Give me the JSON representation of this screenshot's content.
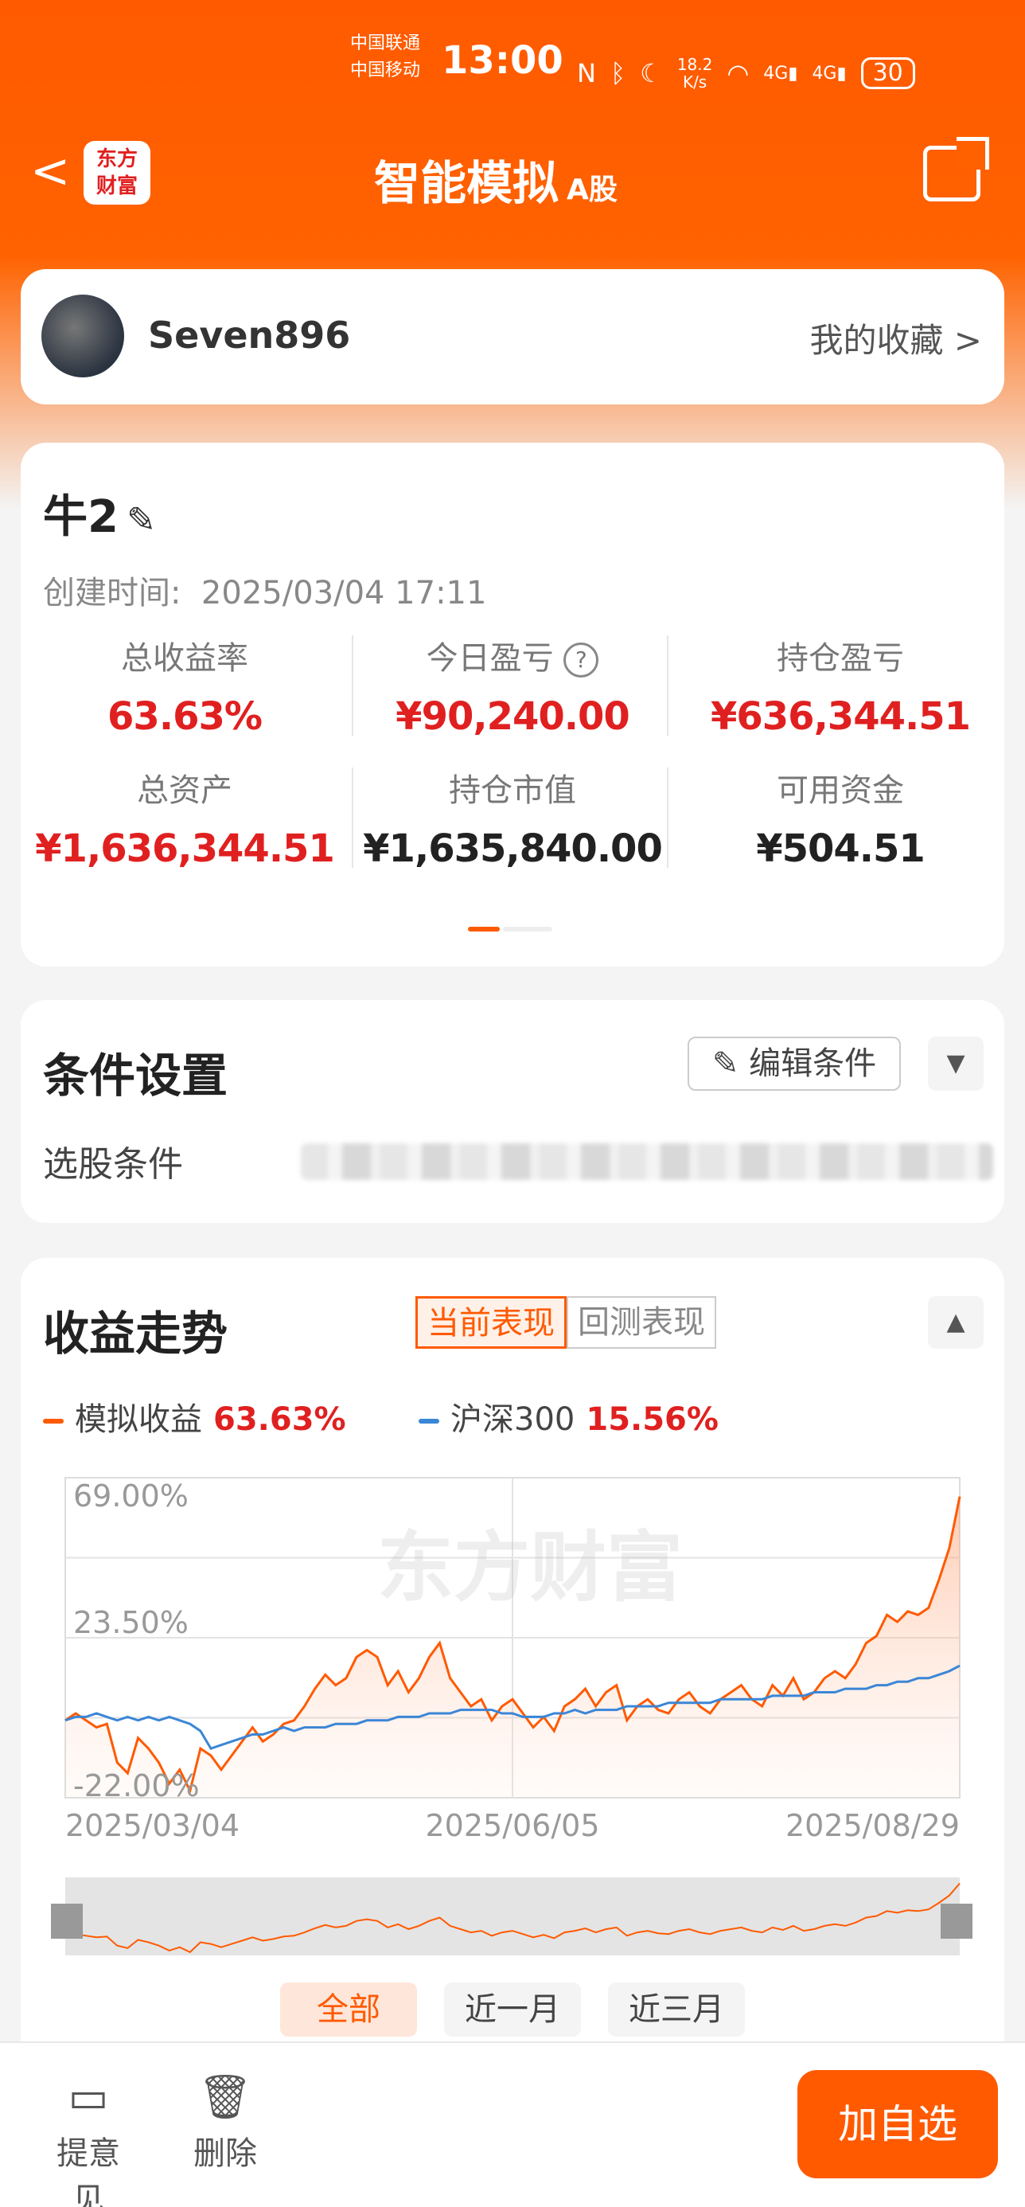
{
  "status_bar": {
    "carrier1": "中国联通",
    "carrier2": "中国移动",
    "time": "13:00",
    "net_speed": "18.2",
    "net_unit": "K/s",
    "battery": "30",
    "signal_4g_1": "4G",
    "signal_4g_2": "4G",
    "icons": [
      "nfc-icon",
      "bluetooth-icon",
      "moon-icon",
      "wifi-icon",
      "signal-icon",
      "battery-icon"
    ]
  },
  "nav": {
    "title": "智能模拟",
    "title_sub": "A股",
    "logo": "东方财富",
    "logo_line1": "东方",
    "logo_line2": "财富"
  },
  "user": {
    "name": "Seven896",
    "favorites": "我的收藏 >"
  },
  "account": {
    "name": "牛2",
    "created_label": "创建时间:",
    "created_time": "2025/03/04 17:11",
    "stats": [
      {
        "label": "总收益率",
        "value": "63.63%",
        "color": "red"
      },
      {
        "label": "今日盈亏",
        "value": "¥90,240.00",
        "color": "red"
      },
      {
        "label": "持仓盈亏",
        "value": "¥636,344.51",
        "color": "red"
      },
      {
        "label": "总资产",
        "value": "¥1,636,344.51",
        "color": "red"
      },
      {
        "label": "持仓市值",
        "value": "¥1,635,840.00",
        "color": "black"
      },
      {
        "label": "可用资金",
        "value": "¥504.51",
        "color": "black"
      }
    ]
  },
  "conditions": {
    "title": "条件设置",
    "edit_label": "编辑条件",
    "select_label": "选股条件"
  },
  "trend": {
    "title": "收益走势",
    "tab_current": "当前表现",
    "tab_backtest": "回测表现",
    "legend": [
      {
        "name": "模拟收益",
        "value": "63.63%",
        "color": "#ff5a00"
      },
      {
        "name": "沪深300",
        "value": "15.56%",
        "color": "#3b86d6"
      }
    ],
    "ranges": [
      "全部",
      "近一月",
      "近三月"
    ]
  },
  "chart_data": {
    "type": "line",
    "x_labels": [
      "2025/03/04",
      "2025/06/05",
      "2025/08/29"
    ],
    "y_tick_labels": [
      "69.00%",
      "23.50%",
      "-22.00%"
    ],
    "ylim": [
      -22.0,
      69.0
    ],
    "watermark": "东方财富",
    "series": [
      {
        "name": "模拟收益",
        "color": "#ff5a00",
        "values": [
          0,
          2,
          0,
          -2,
          -1,
          -12,
          -15,
          -5,
          -8,
          -12,
          -18,
          -14,
          -20,
          -8,
          -10,
          -14,
          -10,
          -6,
          -2,
          -6,
          -4,
          -1,
          0,
          4,
          9,
          13,
          10,
          12,
          18,
          20,
          18,
          10,
          14,
          8,
          12,
          18,
          22,
          12,
          8,
          4,
          6,
          0,
          4,
          6,
          2,
          -2,
          1,
          -3,
          4,
          6,
          9,
          4,
          8,
          10,
          0,
          4,
          6,
          3,
          2,
          6,
          8,
          4,
          2,
          6,
          8,
          10,
          6,
          4,
          10,
          7,
          12,
          6,
          8,
          12,
          14,
          12,
          16,
          22,
          24,
          30,
          28,
          31,
          30,
          32,
          40,
          49,
          63.63
        ]
      },
      {
        "name": "沪深300",
        "color": "#3b86d6",
        "values": [
          0,
          1,
          1,
          2,
          1,
          0,
          1,
          0,
          1,
          0,
          1,
          0,
          -1,
          -3,
          -8,
          -7,
          -6,
          -5,
          -4,
          -4,
          -3,
          -2,
          -3,
          -2,
          -2,
          -2,
          -1,
          -1,
          -1,
          0,
          0,
          0,
          1,
          1,
          1,
          2,
          2,
          2,
          3,
          3,
          3,
          3,
          2,
          2,
          1,
          1,
          1,
          2,
          2,
          3,
          2,
          3,
          3,
          3,
          4,
          4,
          4,
          4,
          5,
          5,
          5,
          5,
          5,
          6,
          6,
          6,
          6,
          6,
          7,
          7,
          7,
          7,
          8,
          8,
          8,
          9,
          9,
          9,
          10,
          10,
          11,
          11,
          12,
          12,
          13,
          14,
          15.56
        ]
      }
    ]
  },
  "bottom": {
    "feedback": "提意见",
    "delete": "删除",
    "add": "加自选"
  }
}
